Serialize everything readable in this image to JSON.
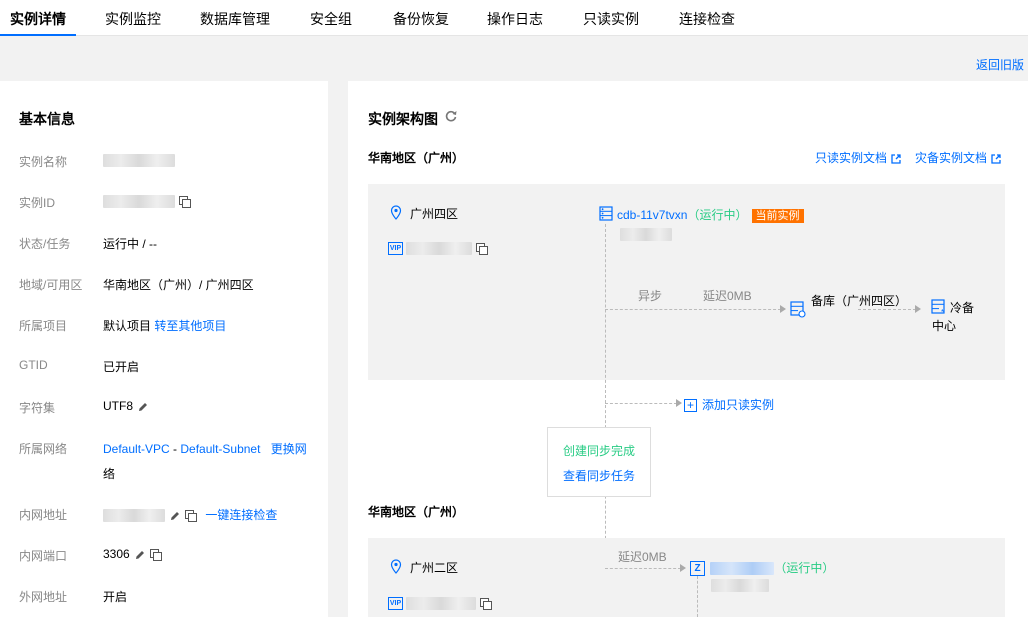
{
  "tabs": [
    {
      "label": "实例详情",
      "active": true
    },
    {
      "label": "实例监控"
    },
    {
      "label": "数据库管理"
    },
    {
      "label": "安全组"
    },
    {
      "label": "备份恢复"
    },
    {
      "label": "操作日志"
    },
    {
      "label": "只读实例"
    },
    {
      "label": "连接检查"
    }
  ],
  "back_link": "返回旧版",
  "basic": {
    "title": "基本信息",
    "rows": [
      {
        "label": "实例名称"
      },
      {
        "label": "实例ID"
      },
      {
        "label": "状态/任务",
        "value": "运行中 / --"
      },
      {
        "label": "地域/可用区",
        "value": "华南地区（广州）/ 广州四区"
      },
      {
        "label": "所属项目",
        "value": "默认项目",
        "link": "转至其他项目"
      },
      {
        "label": "GTID",
        "value": "已开启"
      },
      {
        "label": "字符集",
        "value": "UTF8"
      },
      {
        "label": "所属网络",
        "vpc": "Default-VPC",
        "sep": " - ",
        "subnet": "Default-Subnet",
        "link_a": "更换网",
        "link_b": "络"
      },
      {
        "label": "内网地址",
        "link": "一键连接检查"
      },
      {
        "label": "内网端口",
        "value": "3306"
      },
      {
        "label": "外网地址",
        "link": "开启"
      }
    ]
  },
  "arch": {
    "title": "实例架构图",
    "region1": "华南地区（广州）",
    "doc_readonly": "只读实例文档",
    "doc_disaster": "灾备实例文档",
    "zone1": "广州四区",
    "instance_id": "cdb-11v7tvxn",
    "instance_status": "（运行中）",
    "current_badge": "当前实例",
    "async_label": "异步",
    "delay1": "延迟0MB",
    "backup_label": "备库（广州四区）",
    "cold_line1": "冷备",
    "cold_line2": "中心",
    "add_readonly": "添加只读实例",
    "sync_done": "创建同步完成",
    "sync_view": "查看同步任务",
    "region2": "华南地区（广州）",
    "delay2": "延迟0MB",
    "zone2": "广州二区",
    "instance2_status": "（运行中）",
    "icons": {
      "location": "location-pin-icon",
      "refresh": "refresh-icon",
      "external": "external-link-icon",
      "db": "database-icon"
    },
    "colors": {
      "accent": "#006eff",
      "running": "#29cc85",
      "badge": "#ff7200"
    }
  }
}
